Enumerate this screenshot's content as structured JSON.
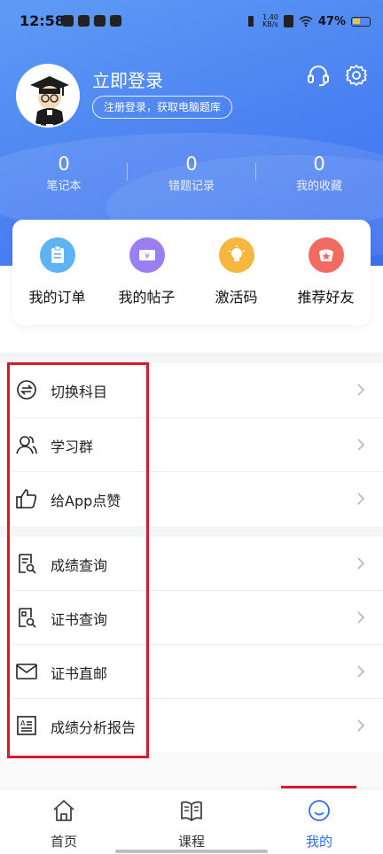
{
  "status_bar": {
    "time": "12:58",
    "speed": "1.40",
    "speed_unit": "KB/s",
    "battery": "47%"
  },
  "profile": {
    "login_label": "立即登录",
    "register_label": "注册登录，获取电脑题库"
  },
  "header_icons": [
    "headset-icon",
    "settings-gear-icon"
  ],
  "stats": [
    {
      "value": "0",
      "label": "笔记本"
    },
    {
      "value": "0",
      "label": "错题记录"
    },
    {
      "value": "0",
      "label": "我的收藏"
    }
  ],
  "shortcuts": [
    {
      "label": "我的订单",
      "icon": "order-clipboard-icon",
      "color": "#4aa3ee"
    },
    {
      "label": "我的帖子",
      "icon": "post-ticket-icon",
      "color": "#8b6ff0"
    },
    {
      "label": "激活码",
      "icon": "activation-bulb-icon",
      "color": "#f4b032"
    },
    {
      "label": "推荐好友",
      "icon": "recommend-star-icon",
      "color": "#f0625a"
    }
  ],
  "menu": {
    "switch_subject": "切换科目",
    "study_group": "学习群",
    "like_app": "给App点赞",
    "score_query": "成绩查询",
    "cert_query": "证书查询",
    "cert_mail": "证书直邮",
    "score_report": "成绩分析报告"
  },
  "tabs": [
    {
      "label": "首页",
      "icon": "home-icon"
    },
    {
      "label": "课程",
      "icon": "book-icon"
    },
    {
      "label": "我的",
      "icon": "smile-face-icon",
      "active": true
    }
  ],
  "colors": {
    "header_blue": "#4f86f2",
    "accent": "#2d6ef2",
    "annotation_red": "#d81b2a"
  }
}
